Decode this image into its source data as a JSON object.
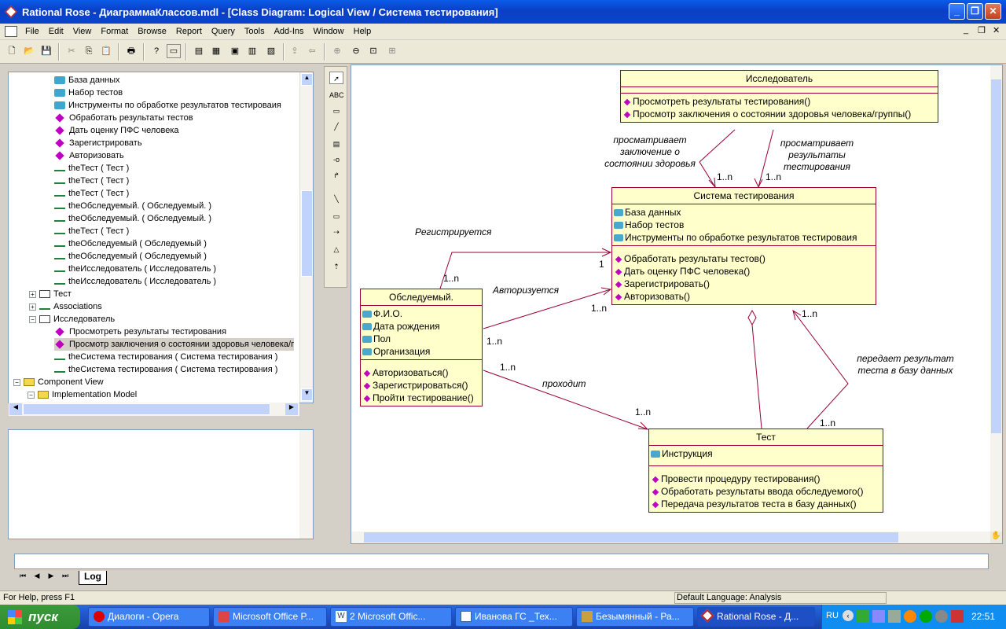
{
  "window": {
    "title": "Rational Rose - ДиаграммаКлассов.mdl - [Class Diagram: Logical View / Система тестирования]"
  },
  "menu": [
    "File",
    "Edit",
    "View",
    "Format",
    "Browse",
    "Report",
    "Query",
    "Tools",
    "Add-Ins",
    "Window",
    "Help"
  ],
  "tree": [
    {
      "label": "База данных",
      "icon": "attribute-icon"
    },
    {
      "label": "Набор тестов",
      "icon": "attribute-icon"
    },
    {
      "label": "Инструменты по обработке результатов тестироваия",
      "icon": "attribute-icon"
    },
    {
      "label": "Обработать результаты тестов",
      "icon": "operation-icon"
    },
    {
      "label": "Дать оценку ПФС человека",
      "icon": "operation-icon"
    },
    {
      "label": "Зарегистрировать",
      "icon": "operation-icon"
    },
    {
      "label": "Авторизовать",
      "icon": "operation-icon"
    },
    {
      "label": "theТест ( Тест )",
      "icon": "role-icon"
    },
    {
      "label": "theТест ( Тест )",
      "icon": "role-icon"
    },
    {
      "label": "theТест ( Тест )",
      "icon": "role-icon"
    },
    {
      "label": "theОбследуемый. ( Обследуемый. )",
      "icon": "role-icon"
    },
    {
      "label": "theОбследуемый. ( Обследуемый. )",
      "icon": "role-icon"
    },
    {
      "label": "theТест ( Тест )",
      "icon": "role-icon"
    },
    {
      "label": "theОбследуемый ( Обследуемый )",
      "icon": "role-icon"
    },
    {
      "label": "theОбследуемый ( Обследуемый )",
      "icon": "role-icon"
    },
    {
      "label": "theИсследователь ( Исследователь )",
      "icon": "role-icon"
    },
    {
      "label": "theИсследователь ( Исследователь )",
      "icon": "role-icon"
    },
    {
      "label": "Тест",
      "icon": "class-icon"
    },
    {
      "label": "Associations",
      "icon": "association-icon"
    },
    {
      "label": "Исследователь",
      "icon": "class-icon"
    },
    {
      "label": "Просмотреть результаты тестирования",
      "icon": "operation-icon"
    },
    {
      "label": "Просмотр заключения о состоянии здоровья человека/г",
      "icon": "operation-icon"
    },
    {
      "label": "theСистема тестирования ( Система тестирования )",
      "icon": "role-icon"
    },
    {
      "label": "theСистема тестирования ( Система тестирования )",
      "icon": "role-icon"
    },
    {
      "label": "Component View",
      "icon": "folder-icon"
    },
    {
      "label": "Implementation Model",
      "icon": "folder-icon"
    }
  ],
  "diagram": {
    "researcher": {
      "name": "Исследователь",
      "ops": [
        "Просмотреть результаты тестирования()",
        "Просмотр заключения о состоянии здоровья человека/группы()"
      ]
    },
    "system": {
      "name": "Система тестирования",
      "attrs": [
        "База данных",
        "Набор тестов",
        "Инструменты по обработке результатов тестироваия"
      ],
      "ops": [
        "Обработать результаты тестов()",
        "Дать оценку ПФС человека()",
        "Зарегистрировать()",
        "Авторизовать()"
      ]
    },
    "examinee": {
      "name": "Обследуемый.",
      "attrs": [
        "Ф.И.О.",
        "Дата рождения",
        "Пол",
        "Организация"
      ],
      "ops": [
        "Авторизоваться()",
        "Зарегистрироваться()",
        "Пройти тестирование()"
      ]
    },
    "test": {
      "name": "Тест",
      "attrs": [
        "Инструкция"
      ],
      "ops": [
        "Провести процедуру тестирования()",
        "Обработать результаты ввода обследуемого()",
        "Передача результатов теста в базу данных()"
      ]
    },
    "labels": {
      "views_conclusion": "просматривает заключение о состоянии здоровья",
      "views_results": "просматривает результаты тестирования",
      "registers": "Регистрируется",
      "authorizes": "Авторизуется",
      "takes": "проходит",
      "passes_result": "передает результат теста в базу данных"
    },
    "mult": {
      "one_n": "1..n",
      "one": "1"
    }
  },
  "log_tab": "Log",
  "status": {
    "help": "For Help, press F1",
    "language": "Default Language: Analysis"
  },
  "taskbar": {
    "start": "пуск",
    "tasks": [
      "Диалоги - Opera",
      "Microsoft Office P...",
      "2 Microsoft Offic...",
      "Иванова ГС _Тех...",
      "Безымянный - Ра...",
      "Rational Rose - Д..."
    ],
    "lang": "RU",
    "clock": "22:51"
  }
}
